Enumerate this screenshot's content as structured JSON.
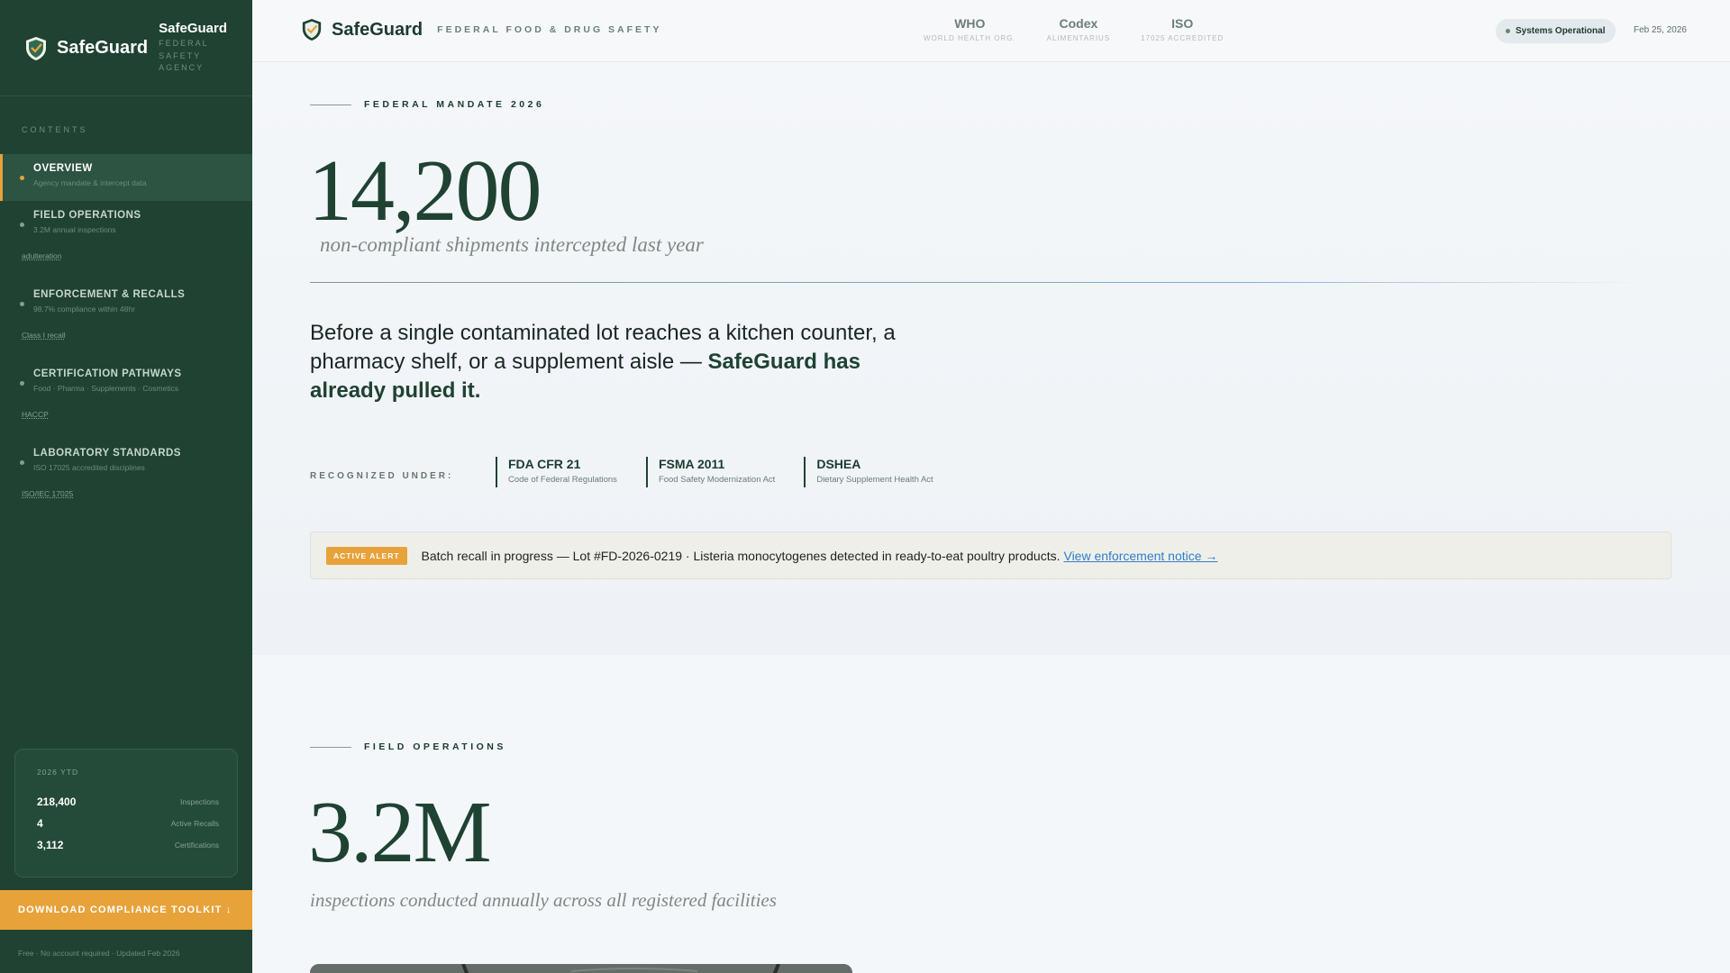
{
  "colors": {
    "sidebar": "#1f4232",
    "accent": "#e8a23a",
    "link": "#2f7ec8"
  },
  "sidebar": {
    "brand_name": "SafeGuard",
    "brand_title": "SafeGuard",
    "brand_subtitle": "Federal Safety Agency",
    "contents_label": "CONTENTS",
    "items": [
      {
        "label": "OVERVIEW",
        "sub": "Agency mandate & intercept data",
        "tag": ""
      },
      {
        "label": "FIELD OPERATIONS",
        "sub": "3.2M annual inspections",
        "tag": "adulteration"
      },
      {
        "label": "ENFORCEMENT & RECALLS",
        "sub": "98.7% compliance within 48hr",
        "tag": "Class I recall"
      },
      {
        "label": "CERTIFICATION PATHWAYS",
        "sub": "Food · Pharma · Supplements · Cosmetics",
        "tag": "HACCP"
      },
      {
        "label": "LABORATORY STANDARDS",
        "sub": "ISO 17025 accredited disciplines",
        "tag": "ISO/IEC 17025"
      }
    ],
    "stats": {
      "year_label": "2026 YTD",
      "rows": [
        {
          "value": "218,400",
          "label": "Inspections"
        },
        {
          "value": "4",
          "label": "Active Recalls"
        },
        {
          "value": "3,112",
          "label": "Certifications"
        }
      ]
    },
    "download_label": "DOWNLOAD COMPLIANCE TOOLKIT",
    "download_icon": "arrow-down-icon",
    "footnote": "Free · No account required · Updated Feb 2026"
  },
  "topbar": {
    "brand_name": "SafeGuard",
    "tagline": "FEDERAL FOOD & DRUG SAFETY",
    "orgs": [
      {
        "name": "WHO",
        "sub": "WORLD HEALTH ORG."
      },
      {
        "name": "Codex",
        "sub": "ALIMENTARIUS"
      },
      {
        "name": "ISO",
        "sub": "17025 ACCREDITED"
      }
    ],
    "status": "Systems Operational",
    "date": "Feb 25, 2026"
  },
  "hero": {
    "section_label": "FEDERAL MANDATE 2026",
    "big_number": "14,200",
    "big_sub": "non-compliant shipments intercepted last year",
    "lead_plain": "Before a single contaminated lot reaches a kitchen counter, a pharmacy shelf, or a supplement aisle — ",
    "lead_bold": "SafeGuard has already pulled it.",
    "recognized_label": "RECOGNIZED UNDER:",
    "regs": [
      {
        "name": "FDA CFR 21",
        "desc": "Code of Federal Regulations"
      },
      {
        "name": "FSMA 2011",
        "desc": "Food Safety Modernization Act"
      },
      {
        "name": "DSHEA",
        "desc": "Dietary Supplement Health Act"
      }
    ],
    "alert": {
      "badge": "ACTIVE ALERT",
      "message": "Batch recall in progress — Lot #FD-2026-0219 · Listeria monocytogenes detected in ready-to-eat poultry products.",
      "link": "View enforcement notice →"
    }
  },
  "field": {
    "section_label": "FIELD OPERATIONS",
    "big_number": "3.2M",
    "big_sub": "inspections conducted annually across all registered facilities"
  }
}
